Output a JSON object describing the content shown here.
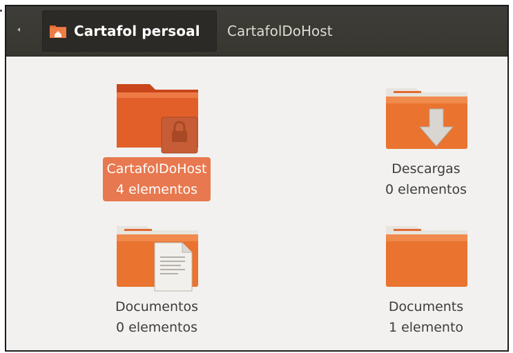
{
  "pathbar": {
    "home_label": "Cartafol persoal",
    "current_label": "CartafolDoHost"
  },
  "items": [
    {
      "name": "CartafolDoHost",
      "count": "4 elementos",
      "selected": true,
      "icon": "locked-folder-icon"
    },
    {
      "name": "Descargas",
      "count": "0 elementos",
      "selected": false,
      "icon": "downloads-folder-icon"
    },
    {
      "name": "Documentos",
      "count": "0 elementos",
      "selected": false,
      "icon": "documents-folder-icon"
    },
    {
      "name": "Documents",
      "count": "1 elemento",
      "selected": false,
      "icon": "folder-icon"
    }
  ],
  "colors": {
    "accent": "#e8784f",
    "folder_orange": "#e0602a",
    "toolbar_dark": "#3c3b37"
  }
}
